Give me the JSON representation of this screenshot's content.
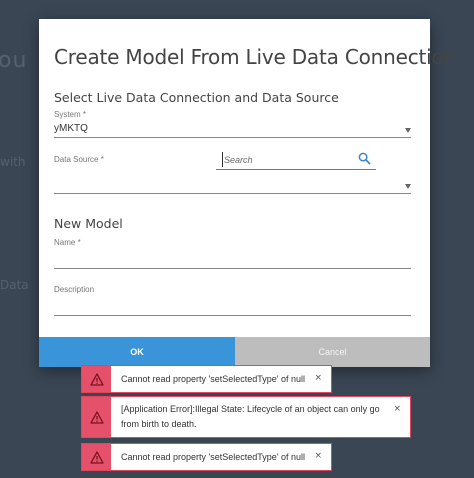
{
  "background": {
    "fragment_top": "ou",
    "fragment_mid": "with",
    "fragment_bottom": "Data"
  },
  "modal": {
    "title": "Create Model From Live Data Connection",
    "section_connection": "Select Live Data Connection and Data Source",
    "system_label": "System *",
    "system_value": "yMKTQ",
    "data_source_label": "Data Source *",
    "data_source_value": "",
    "search_placeholder": "Search",
    "section_model": "New Model",
    "name_label": "Name *",
    "description_label": "Description",
    "ok_label": "OK",
    "cancel_label": "Cancel"
  },
  "toasts": [
    {
      "message": "Cannot read property 'setSelectedType' of null",
      "close": "×"
    },
    {
      "message": "[Application Error]:Illegal State: Lifecycle of an object can only go from birth to death.",
      "close": "×"
    },
    {
      "message": "Cannot read property 'setSelectedType' of null",
      "close": "×"
    }
  ],
  "colors": {
    "primary": "#3a94d9",
    "cancel": "#bdbdbd",
    "error": "#e5506a",
    "backdrop": "#3a4654"
  },
  "icons": {
    "search": "search-icon",
    "warning": "warning-icon",
    "dropdown": "chevron-down-icon"
  }
}
